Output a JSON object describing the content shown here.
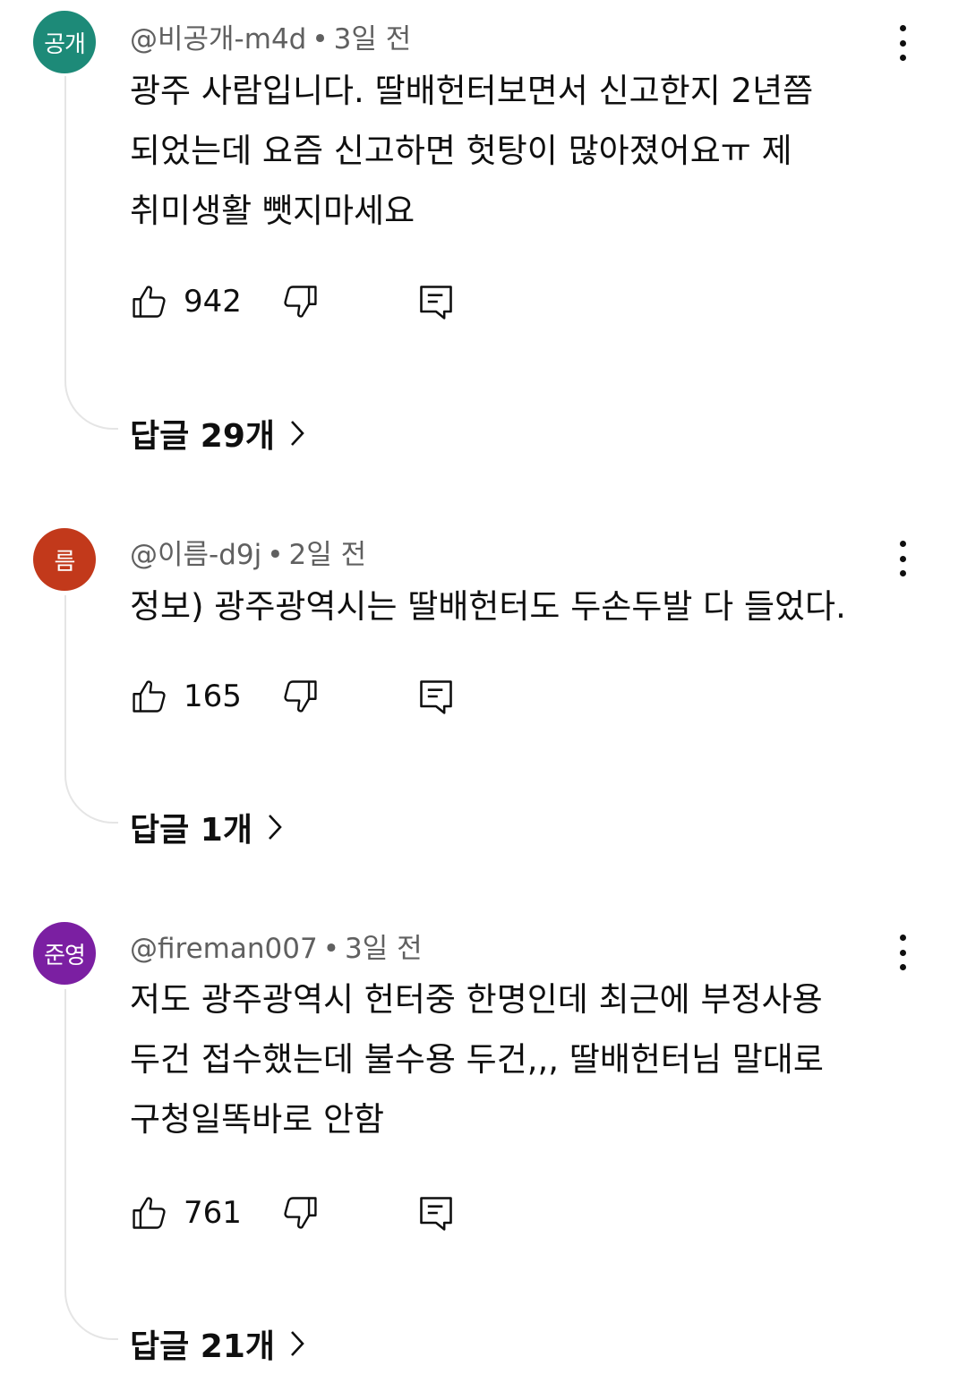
{
  "comments": [
    {
      "avatar_text": "공개",
      "avatar_color": "#1d8a78",
      "author": "@비공개-m4d",
      "time": "3일 전",
      "text": "광주 사람입니다. 딸배헌터보면서 신고한지 2년쯤\n되었는데 요즘 신고하면 헛탕이 많아졌어요ㅠ 제\n취미생활 뺏지마세요",
      "likes": "942",
      "replies_label": "답글 29개"
    },
    {
      "avatar_text": "름",
      "avatar_color": "#c2391b",
      "author": "@이름-d9j",
      "time": "2일 전",
      "text": "정보) 광주광역시는 딸배헌터도 두손두발 다 들었다.",
      "likes": "165",
      "replies_label": "답글 1개"
    },
    {
      "avatar_text": "준영",
      "avatar_color": "#7b1fa2",
      "author": "@fireman007",
      "time": "3일 전",
      "text": "저도 광주광역시 헌터중 한명인데 최근에 부정사용\n두건 접수했는데 불수용 두건,,, 딸배헌터님 말대로\n구청일똑바로 안함",
      "likes": "761",
      "replies_label": "답글 21개"
    }
  ]
}
